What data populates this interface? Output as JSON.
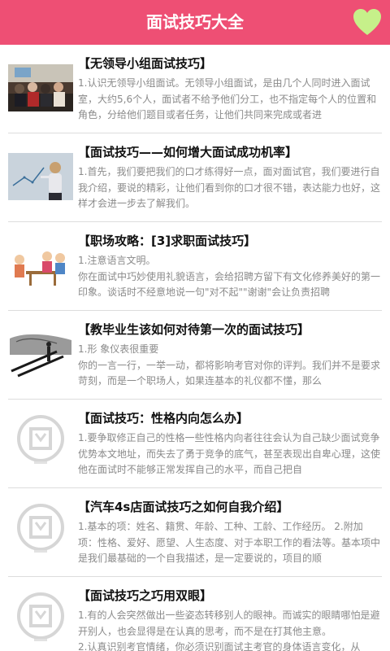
{
  "header": {
    "title": "面试技巧大全",
    "heart_icon": "heart-icon",
    "accent": "#ee4f74",
    "heart_color": "#c6f08a"
  },
  "items": [
    {
      "title": "【无领导小组面试技巧】",
      "desc": "1.认识无领导小组面试。无领导小组面试，是由几个人同时进入面试室，大约5,6个人，面试者不给予他们分工，也不指定每个人的位置和角色，分给他们题目或者任务，让他们共同来完成或者进"
    },
    {
      "title": "【面试技巧——如何增大面试成功机率】",
      "desc": "1.首先，我们要把我们的口才练得好一点，面对面试官，我们要进行自我介绍，要说的精彩，让他们看到你的口才很不错，表达能力也好，这样才会进一步去了解我们。"
    },
    {
      "title": "【职场攻略：[3]求职面试技巧】",
      "desc": "1.注意语言文明。\n你在面试中巧妙使用礼貌语言，会给招聘方留下有文化修养美好的第一印象。谈话时不经意地说一句\"对不起\"\"谢谢\"会让负责招聘"
    },
    {
      "title": "【教毕业生该如何对待第一次的面试技巧】",
      "desc": "1.形 象仪表很重要\n  你的一言一行，一举一动，都将影响考官对你的评判。我们并不是要求苛刻，而是一个职场人，如果连基本的礼仪都不懂，那么"
    },
    {
      "title": "【面试技巧：性格内向怎么办】",
      "desc": "1.要争取修正自己的性格一些性格内向者往往会认为自己缺少面试竞争优势本文地址，而失去了勇于竞争的底气，甚至表现出自卑心理，这使他在面试时不能够正常发挥自己的水平，而自己把自"
    },
    {
      "title": "【汽车4s店面试技巧之如何自我介绍】",
      "desc": "1.基本的项：姓名、籍贯、年龄、工种、工龄、工作经历。 2.附加项：性格、爱好、愿望、人生态度、对于本职工作的看法等。基本项中是我们最基础的一个自我描述，是一定要说的，项目的顺"
    },
    {
      "title": "【面试技巧之巧用双眼】",
      "desc": "1.有的人会突然做出一些姿态转移别人的眼神。而诚实的眼睛哪怕是避开别人，也会显得是在认真的思考，而不是在打其他主意。\n2.认真识别考官情绪，你必须识别面试主考官的身体语言变化，从"
    }
  ],
  "placeholder_logo_icon": "app-logo-placeholder-icon"
}
